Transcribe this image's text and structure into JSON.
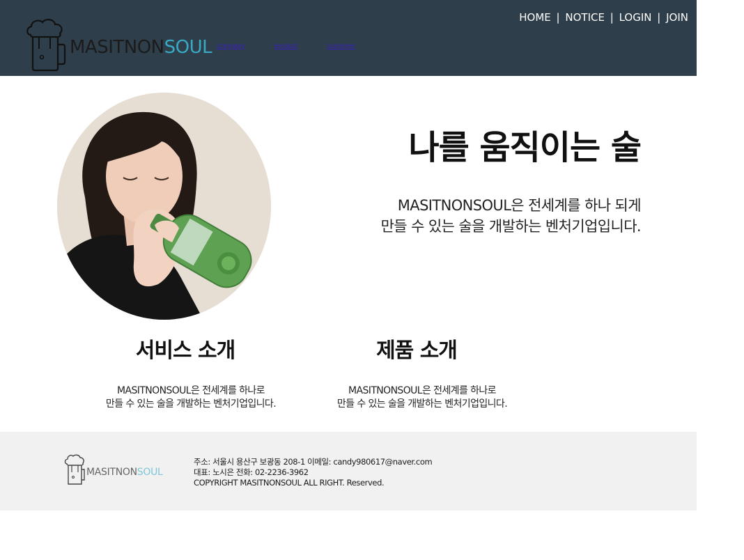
{
  "header": {
    "logo": {
      "dark": "MASITNON",
      "light": "SOUL"
    },
    "nav_links": [
      {
        "label": "company"
      },
      {
        "label": "product"
      },
      {
        "label": "customer"
      }
    ],
    "top_menu": [
      {
        "label": "HOME"
      },
      {
        "label": "NOTICE"
      },
      {
        "label": "LOGIN"
      },
      {
        "label": "JOIN"
      }
    ],
    "top_menu_separator": "|"
  },
  "hero": {
    "title": "나를 움직이는 술",
    "description_lines": [
      "MASITNONSOUL은 전세계를 하나 되게",
      "만들 수 있는 술을 개발하는 벤처기업입니다."
    ]
  },
  "sections": [
    {
      "title": "서비스 소개",
      "description_lines": [
        "MASITNONSOUL은 전세계를 하나로",
        "만들 수 있는 술을 개발하는 벤처기업입니다."
      ]
    },
    {
      "title": "제품 소개",
      "description_lines": [
        "MASITNONSOUL은 전세계를 하나로",
        "만들 수 있는 술을 개발하는 벤처기업입니다."
      ]
    }
  ],
  "footer": {
    "logo": {
      "dark": "MASITNON",
      "light": "SOUL"
    },
    "info_lines": [
      "주소: 서울시 용산구 보광동 208-1   이메일: candy980617@naver.com",
      "대표: 노시은     전화: 02-2236-3962",
      "COPYRIGHT MASITNONSOUL ALL RIGHT. Reserved."
    ]
  },
  "colors": {
    "header_bg": "#2e3e4a",
    "logo_accent": "#39a9c4",
    "nav_link": "#3a21b6",
    "footer_bg": "#f1f1f1"
  }
}
